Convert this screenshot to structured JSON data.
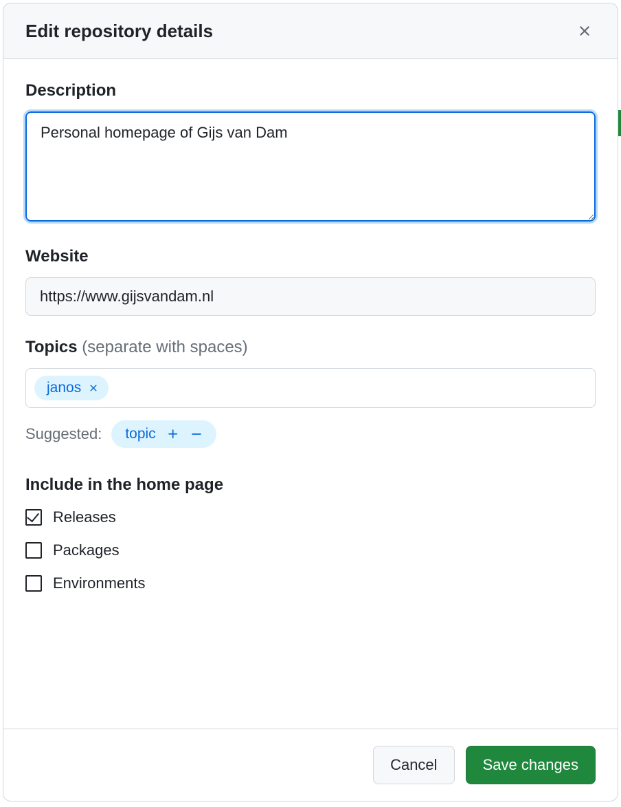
{
  "dialog": {
    "title": "Edit repository details"
  },
  "description": {
    "label": "Description",
    "value": "Personal homepage of Gijs van Dam"
  },
  "website": {
    "label": "Website",
    "value": "https://www.gijsvandam.nl"
  },
  "topics": {
    "label": "Topics",
    "hint": "(separate with spaces)",
    "tags": [
      "janos"
    ],
    "suggested_label": "Suggested:",
    "suggested": [
      "topic"
    ]
  },
  "include": {
    "title": "Include in the home page",
    "options": [
      {
        "label": "Releases",
        "checked": true
      },
      {
        "label": "Packages",
        "checked": false
      },
      {
        "label": "Environments",
        "checked": false
      }
    ]
  },
  "footer": {
    "cancel": "Cancel",
    "save": "Save changes"
  }
}
